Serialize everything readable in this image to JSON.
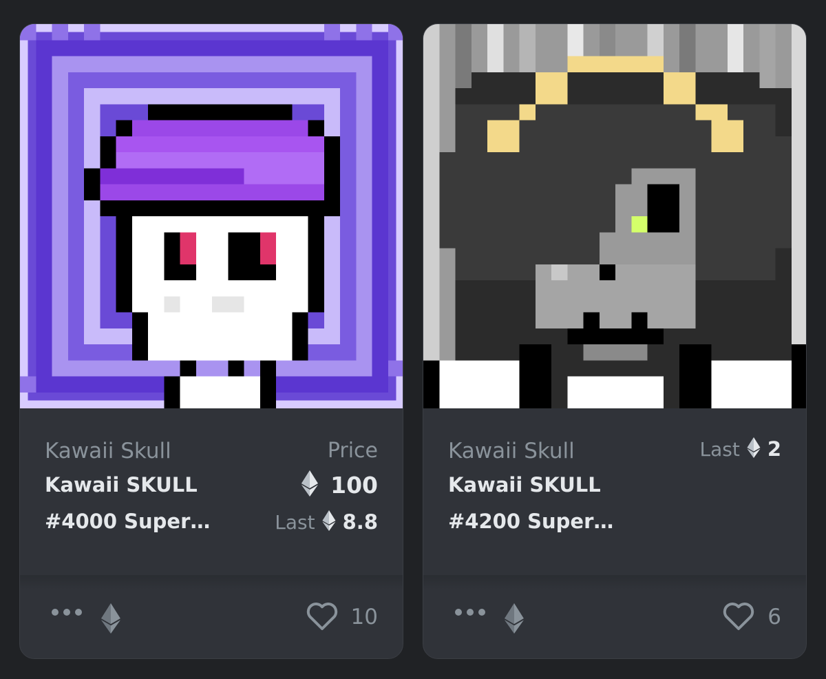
{
  "cards": [
    {
      "collection": "Kawaii Skull",
      "name_line1": "Kawaii SKULL",
      "name_line2": "#4000 Super…",
      "price_label": "Price",
      "price_value": "100",
      "last_label": "Last",
      "last_value": "8.8",
      "favorites": "10",
      "chain_icon": "ethereum-icon",
      "menu_icon": "more-icon",
      "like_icon": "heart-icon",
      "art": "purple pixel skull with purple hat"
    },
    {
      "collection": "Kawaii Skull",
      "name_line1": "Kawaii SKULL",
      "name_line2": "#4200 Super…",
      "last_label": "Last",
      "last_value": "2",
      "favorites": "6",
      "chain_icon": "ethereum-icon",
      "menu_icon": "more-icon",
      "like_icon": "heart-icon",
      "art": "grayscale pixel skull with halo"
    }
  ],
  "colors": {
    "page_bg": "#202225",
    "card_bg": "#303339",
    "muted_text": "#8a939b",
    "primary_text": "#e5e8eb",
    "accent_purple": "#7f4fe0"
  }
}
